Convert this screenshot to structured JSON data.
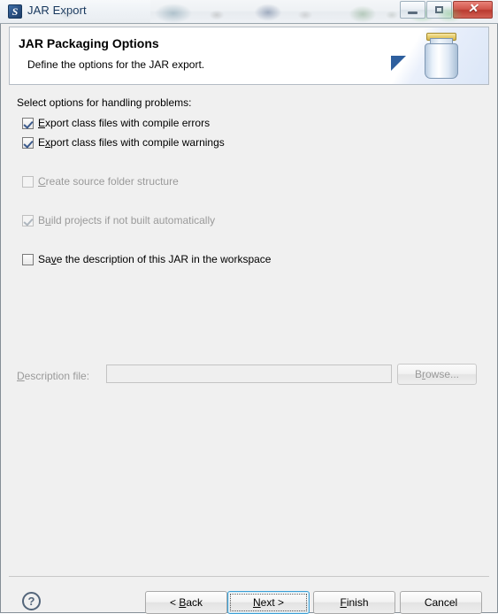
{
  "window": {
    "title": "JAR Export",
    "icon": "jar-export-icon",
    "controls": {
      "minimize": "Minimize",
      "maximize": "Maximize",
      "close": "Close",
      "close_glyph": "✕"
    }
  },
  "header": {
    "title": "JAR Packaging Options",
    "description": "Define the options for the JAR export.",
    "icon": "jar-banner-icon"
  },
  "content": {
    "group_label": "Select options for handling problems:",
    "options": [
      {
        "name": "export-class-files-compile-errors",
        "prefix": "",
        "mnemonic": "E",
        "suffix": "xport class files with compile errors",
        "checked": true,
        "enabled": true
      },
      {
        "name": "export-class-files-compile-warnings",
        "prefix": "E",
        "mnemonic": "x",
        "suffix": "port class files with compile warnings",
        "checked": true,
        "enabled": true
      },
      {
        "name": "create-source-folder-structure",
        "prefix": "",
        "mnemonic": "C",
        "suffix": "reate source folder structure",
        "checked": false,
        "enabled": false
      },
      {
        "name": "build-projects-if-not-built-automatically",
        "prefix": "B",
        "mnemonic": "u",
        "suffix": "ild projects if not built automatically",
        "checked": true,
        "enabled": false
      },
      {
        "name": "save-description-of-jar-in-workspace",
        "prefix": "Sa",
        "mnemonic": "v",
        "suffix": "e the description of this JAR in the workspace",
        "checked": false,
        "enabled": true
      }
    ],
    "description_file": {
      "label_prefix": "",
      "label_mnemonic": "D",
      "label_suffix": "escription file:",
      "value": "",
      "placeholder": "",
      "enabled": false
    },
    "browse": {
      "prefix": "B",
      "mnemonic": "r",
      "suffix": "owse...",
      "enabled": false
    }
  },
  "footer": {
    "help": "?",
    "buttons": [
      {
        "name": "back-button",
        "prefix": "< ",
        "mnemonic": "B",
        "suffix": "ack",
        "default": false
      },
      {
        "name": "next-button",
        "prefix": "",
        "mnemonic": "N",
        "suffix": "ext >",
        "default": true
      },
      {
        "name": "finish-button",
        "prefix": "",
        "mnemonic": "F",
        "suffix": "inish",
        "default": false
      },
      {
        "name": "cancel-button",
        "prefix": "Cancel",
        "mnemonic": "",
        "suffix": "",
        "default": false
      }
    ]
  },
  "colors": {
    "dialog_background": "#f0f0f0",
    "header_background": "#ffffff",
    "title_text": "#16365c",
    "disabled_text": "#9a9a9a",
    "default_button_border": "#3c9fd4",
    "close_button": "#ba3a30",
    "checkmark": "#3b5a8c"
  }
}
